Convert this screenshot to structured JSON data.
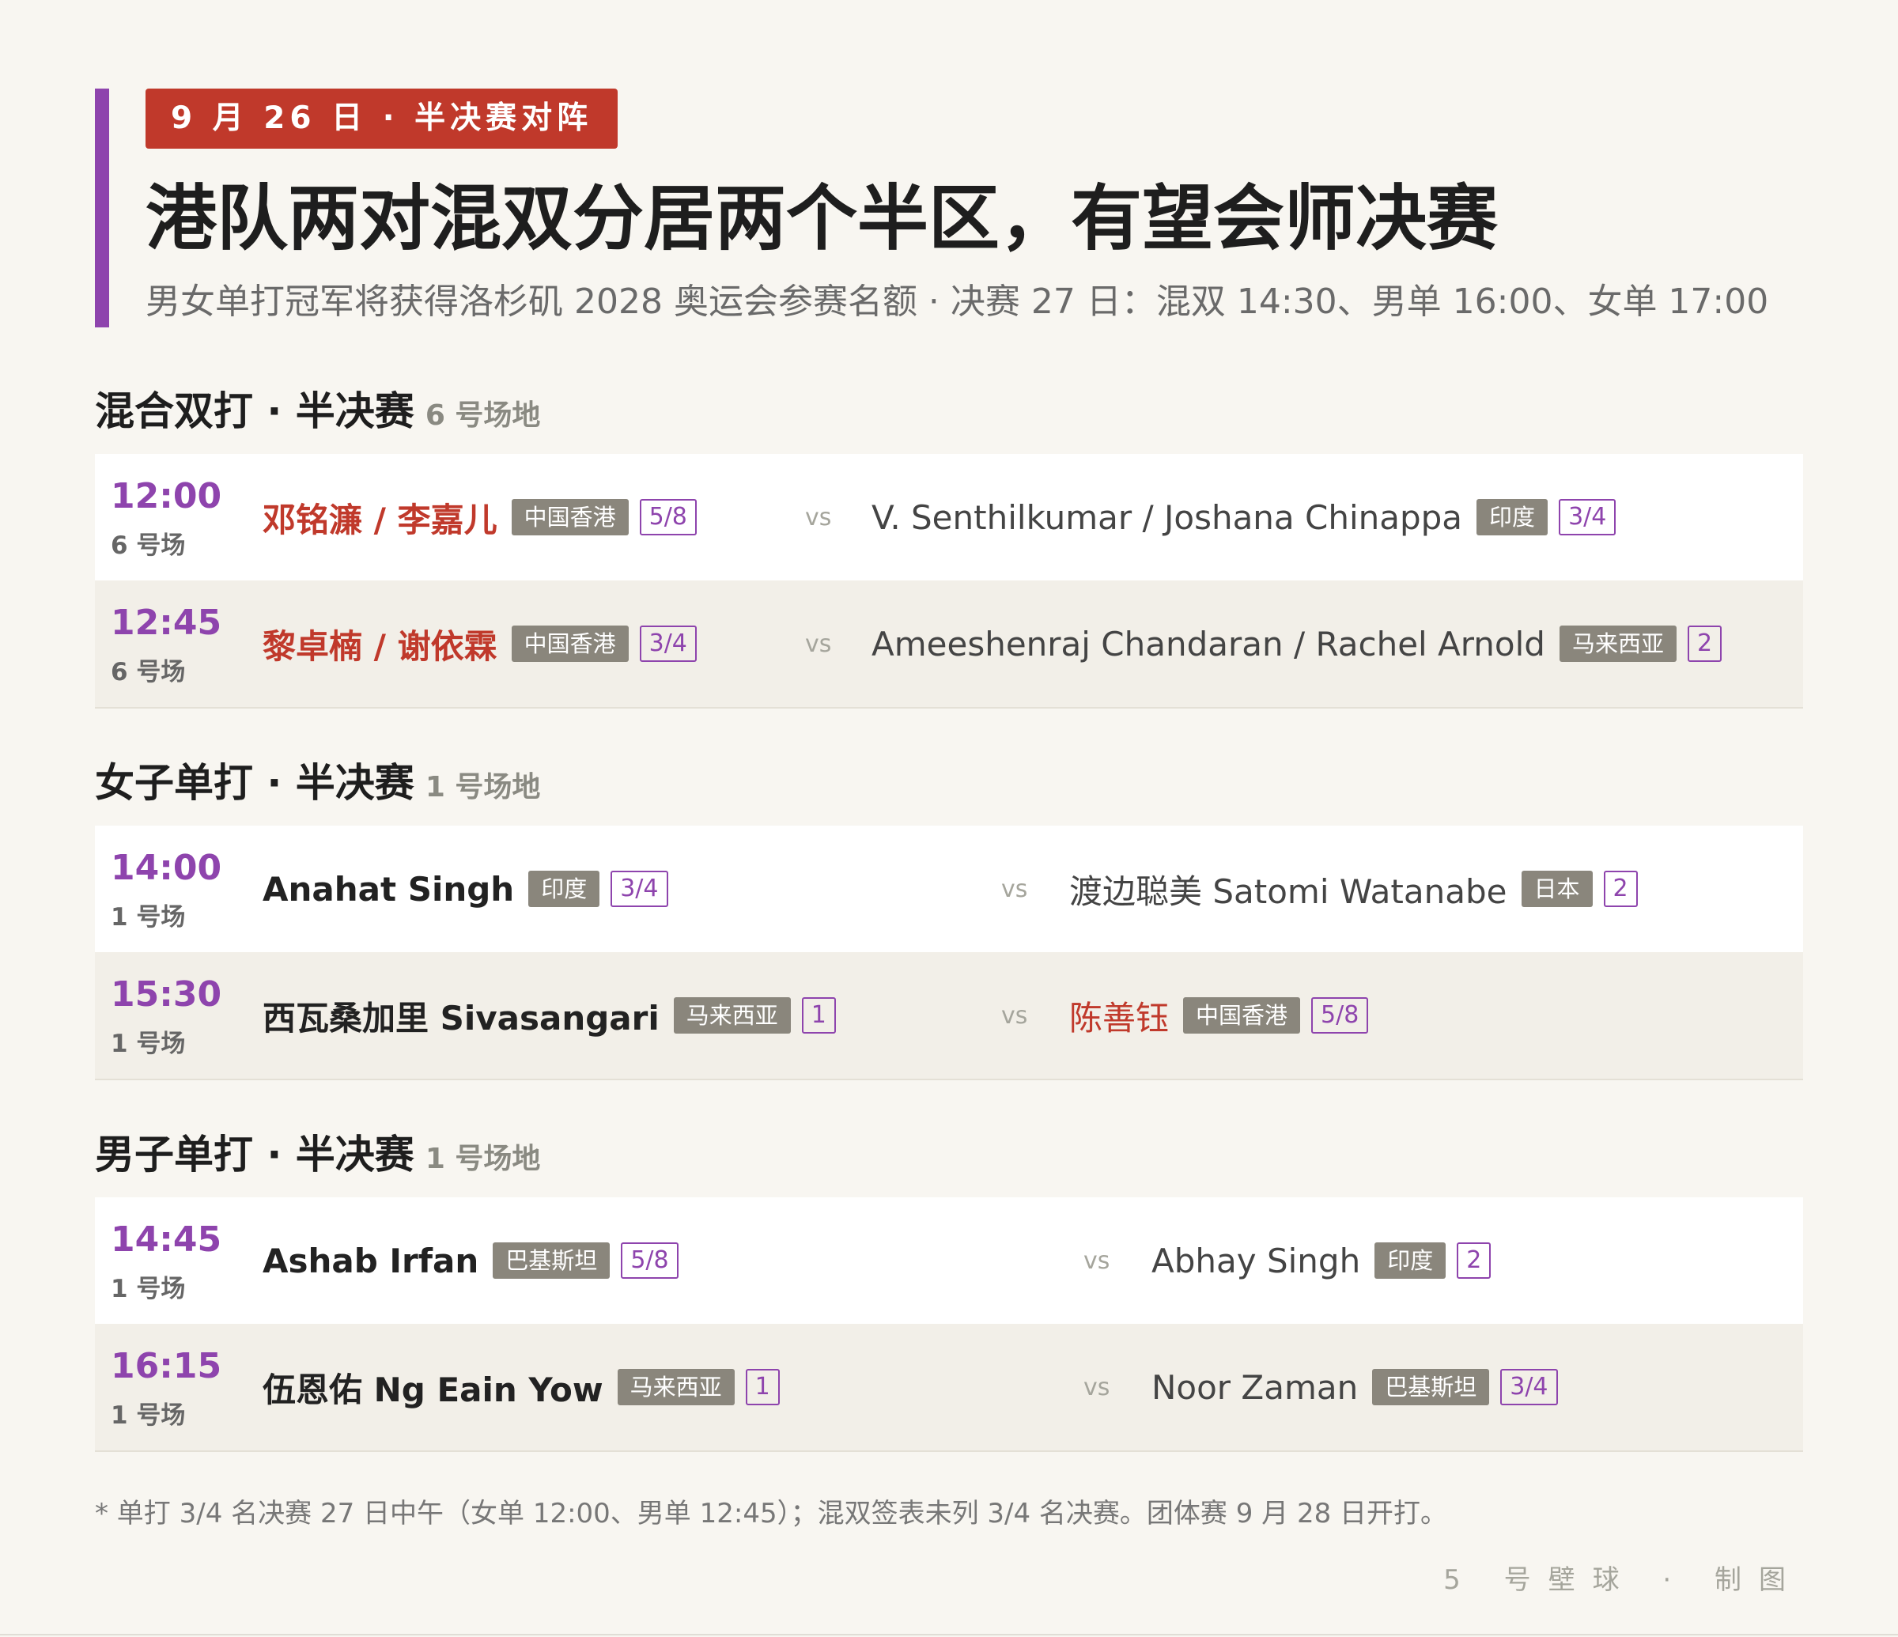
{
  "header": {
    "tag": "9 月 26 日 · 半决赛对阵",
    "title": "港队两对混双分居两个半区，有望会师决赛",
    "subtitle": "男女单打冠军将获得洛杉矶 2028 奥运会参赛名额 · 决赛 27 日：混双 14:30、男单 16:00、女单 17:00"
  },
  "sections": [
    {
      "title": "混合双打 · 半决赛",
      "venue": "6 号场地",
      "matches": [
        {
          "time": "12:00",
          "court": "6 号场",
          "p1": {
            "name": "邓铭濂 / 李嘉儿",
            "country": "中国香港",
            "seed": "5/8"
          },
          "vs": "vs",
          "p2": {
            "name": "V. Senthilkumar / Joshana Chinappa",
            "country": "印度",
            "seed": "3/4"
          }
        },
        {
          "time": "12:45",
          "court": "6 号场",
          "p1": {
            "name": "黎卓楠 / 谢依霖",
            "country": "中国香港",
            "seed": "3/4"
          },
          "vs": "vs",
          "p2": {
            "name": "Ameeshenraj Chandaran / Rachel Arnold",
            "country": "马来西亚",
            "seed": "2"
          }
        }
      ]
    },
    {
      "title": "女子单打 · 半决赛",
      "venue": "1 号场地",
      "matches": [
        {
          "time": "14:00",
          "court": "1 号场",
          "p1": {
            "name": "Anahat Singh",
            "country": "印度",
            "seed": "3/4"
          },
          "vs": "vs",
          "p2": {
            "name": "渡边聪美 Satomi Watanabe",
            "country": "日本",
            "seed": "2"
          }
        },
        {
          "time": "15:30",
          "court": "1 号场",
          "p1": {
            "name": "西瓦桑加里 Sivasangari",
            "country": "马来西亚",
            "seed": "1"
          },
          "vs": "vs",
          "p2": {
            "name": "陈善钰",
            "country": "中国香港",
            "seed": "5/8"
          }
        }
      ]
    },
    {
      "title": "男子单打 · 半决赛",
      "venue": "1 号场地",
      "matches": [
        {
          "time": "14:45",
          "court": "1 号场",
          "p1": {
            "name": "Ashab Irfan",
            "country": "巴基斯坦",
            "seed": "5/8"
          },
          "vs": "vs",
          "p2": {
            "name": "Abhay Singh",
            "country": "印度",
            "seed": "2"
          }
        },
        {
          "time": "16:15",
          "court": "1 号场",
          "p1": {
            "name": "伍恩佑 Ng Eain Yow",
            "country": "马来西亚",
            "seed": "1"
          },
          "vs": "vs",
          "p2": {
            "name": "Noor Zaman",
            "country": "巴基斯坦",
            "seed": "3/4"
          }
        }
      ]
    }
  ],
  "footnote": "* 单打 3/4 名决赛 27 日中午（女单 12:00、男单 12:45）；混双签表未列 3/4 名决赛。团体赛 9 月 28 日开打。",
  "credit": "5 号壁球 · 制图",
  "colors": {
    "accent": "#8e44ad",
    "tag": "#c0392b",
    "hk": "#c0392b",
    "country_badge": "#8a867c"
  }
}
